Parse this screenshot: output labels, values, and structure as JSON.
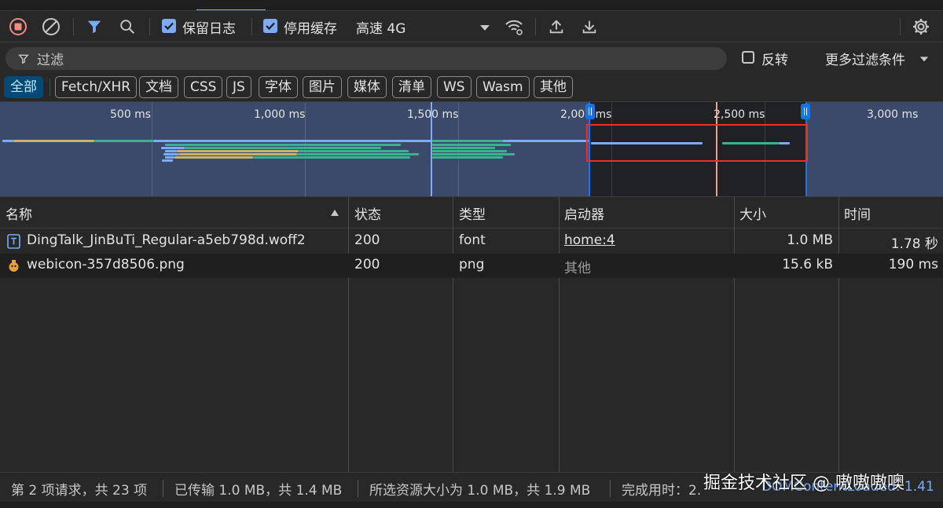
{
  "toolbar": {
    "preserve_log": "保留日志",
    "disable_cache": "停用缓存",
    "throttling": "高速 4G"
  },
  "filter": {
    "placeholder": "过滤",
    "invert": "反转",
    "more_filters": "更多过滤条件"
  },
  "type_filters": [
    "全部",
    "Fetch/XHR",
    "文档",
    "CSS",
    "JS",
    "字体",
    "图片",
    "媒体",
    "清单",
    "WS",
    "Wasm",
    "其他"
  ],
  "overview": {
    "ticks": [
      "500 ms",
      "1,000 ms",
      "1,500 ms",
      "2,000 ms",
      "2,500 ms",
      "3,000 ms"
    ]
  },
  "table": {
    "headers": [
      "名称",
      "状态",
      "类型",
      "启动器",
      "大小",
      "时间"
    ],
    "rows": [
      {
        "name": "DingTalk_JinBuTi_Regular-a5eb798d.woff2",
        "status": "200",
        "type": "font",
        "initiator": "home:4",
        "size": "1.0 MB",
        "time": "1.78 秒"
      },
      {
        "name": "webicon-357d8506.png",
        "status": "200",
        "type": "png",
        "initiator": "其他",
        "size": "15.6 kB",
        "time": "190 ms"
      }
    ]
  },
  "status": {
    "requests": "第 2 项请求，共 23 项",
    "transferred": "已传输 1.0 MB，共 1.4 MB",
    "resources": "所选资源大小为 1.0 MB，共 1.9 MB",
    "finish": "完成用时：2.",
    "dom": "DOMContentLoaded: 1.41"
  },
  "watermark": "掘金技术社区 @ 嗷嗷嗷噢",
  "colors": {
    "accent": "#7cacf8",
    "selection": "#1a73e8",
    "highlight_box": "#e8312a"
  }
}
